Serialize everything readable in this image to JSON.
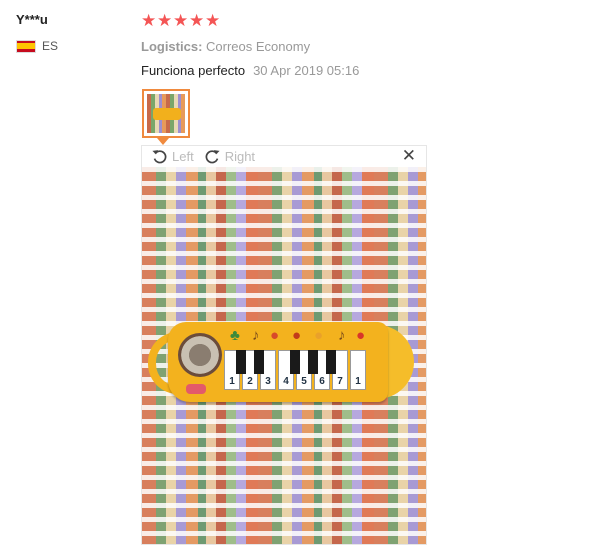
{
  "reviewer": {
    "name": "Y***u",
    "country_code": "ES",
    "flag_icon": "spain-flag-icon"
  },
  "rating": {
    "stars": 5,
    "max": 5,
    "star_symbol": "★",
    "color": "#f45555"
  },
  "logistics": {
    "label": "Logistics:",
    "value": "Correos Economy"
  },
  "review": {
    "text": "Funciona perfecto",
    "date": "30 Apr 2019 05:16"
  },
  "viewer": {
    "rotate_left_label": "Left",
    "rotate_right_label": "Right",
    "close_symbol": "✕"
  },
  "photo": {
    "keyboard_numbers": [
      "1",
      "2",
      "3",
      "4",
      "5",
      "6",
      "7",
      "1"
    ]
  },
  "colors": {
    "accent_border": "#f08a3e",
    "muted_text": "#999999"
  }
}
